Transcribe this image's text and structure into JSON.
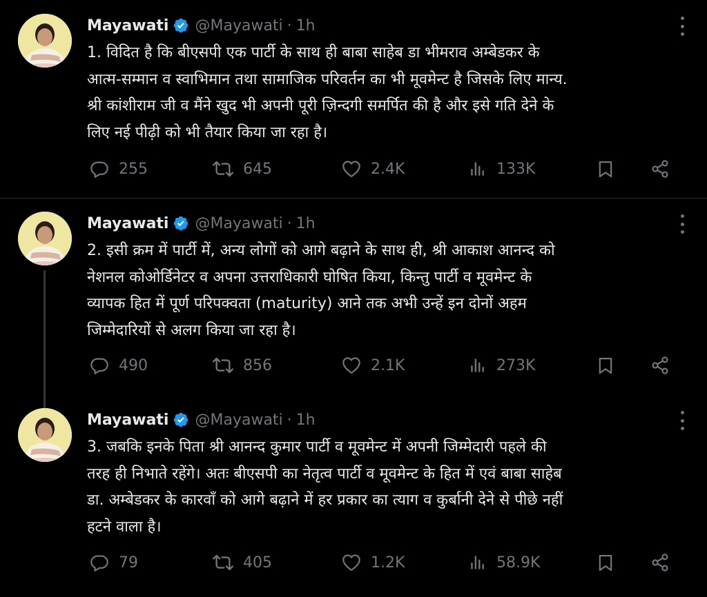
{
  "colors": {
    "background": "#000000",
    "text": "#e7e9ea",
    "muted": "#71767b",
    "verified_badge": "#1d9bf0",
    "separator": "#2f3336"
  },
  "tweets": [
    {
      "author": "Mayawati",
      "handle": "@Mayawati",
      "separator": "·",
      "time": "1h",
      "lines": [
        "1. विदित है कि बीएसपी एक पार्टी के साथ ही बाबा साहेब डा भीमराव अम्बेडकर के",
        "आत्म-सम्मान व स्वाभिमान तथा सामाजिक परिवर्तन का भी मूवमेन्ट है जिसके लिए मान्य.",
        "श्री कांशीराम जी व मैंने खुद भी अपनी पूरी ज़िन्दगी समर्पित की है और इसे गति देने के",
        "लिए नई पीढ़ी को भी तैयार किया जा रहा है।"
      ],
      "replies": "255",
      "reposts": "645",
      "likes": "2.4K",
      "views": "133K"
    },
    {
      "author": "Mayawati",
      "handle": "@Mayawati",
      "separator": "·",
      "time": "1h",
      "lines": [
        "2. इसी क्रम में पार्टी में, अन्य लोगों को आगे बढ़ाने के साथ ही, श्री आकाश आनन्द को",
        "नेशनल कोओर्डिनेटर व अपना उत्तराधिकारी घोषित किया, किन्तु पार्टी व मूवमेन्ट के",
        "व्यापक हित में पूर्ण परिपक्वता (maturity) आने तक अभी उन्हें इन दोनों अहम",
        "जिम्मेदारियों से अलग किया जा रहा है।"
      ],
      "replies": "490",
      "reposts": "856",
      "likes": "2.1K",
      "views": "273K"
    },
    {
      "author": "Mayawati",
      "handle": "@Mayawati",
      "separator": "·",
      "time": "1h",
      "lines": [
        "3. जबकि इनके पिता श्री आनन्द कुमार पार्टी व मूवमेन्ट में अपनी जिम्मेदारी पहले की",
        "तरह ही निभाते रहेंगे। अतः बीएसपी का नेतृत्व पार्टी व मूवमेन्ट के हित में एवं बाबा साहेब",
        "डा. अम्बेडकर के कारवाँ को आगे बढ़ाने में हर प्रकार का त्याग व कुर्बानी देने से पीछे नहीं",
        "हटने वाला है।"
      ],
      "replies": "79",
      "reposts": "405",
      "likes": "1.2K",
      "views": "58.9K"
    }
  ],
  "icons": {
    "reply": "reply-icon",
    "repost": "repost-icon",
    "like": "heart-icon",
    "views": "views-icon",
    "bookmark": "bookmark-icon",
    "share": "share-icon",
    "verified": "verified-badge-icon",
    "more": "more-options-icon"
  }
}
